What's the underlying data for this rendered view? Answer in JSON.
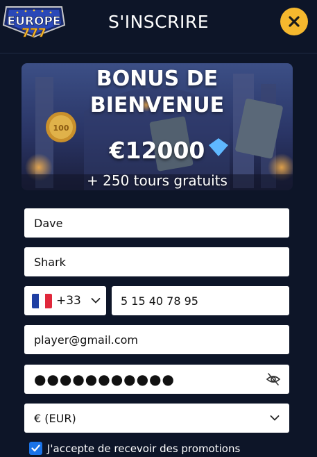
{
  "header": {
    "logo_text": "EUROPE",
    "logo_sub": "777",
    "title": "S'INSCRIRE",
    "close_icon": "close-icon"
  },
  "banner": {
    "title_line1": "BONUS DE",
    "title_line2": "BIENVENUE",
    "amount": "€12000",
    "spins": "+ 250 tours gratuits"
  },
  "form": {
    "first_name": "Dave",
    "last_name": "Shark",
    "phone_country_code": "+33",
    "phone_number": "5 15 40 78 95",
    "email": "player@gmail.com",
    "password_masked": "●●●●●●●●●●●",
    "currency": "€ (EUR)",
    "promotions_label": "J'accepte de recevoir des promotions",
    "promotions_checked": true
  },
  "colors": {
    "background": "#0d1528",
    "close_button": "#f5b82e",
    "checkbox": "#1a73e8",
    "flag_blue": "#1f3fa3",
    "flag_white": "#ffffff",
    "flag_red": "#e0283b"
  }
}
